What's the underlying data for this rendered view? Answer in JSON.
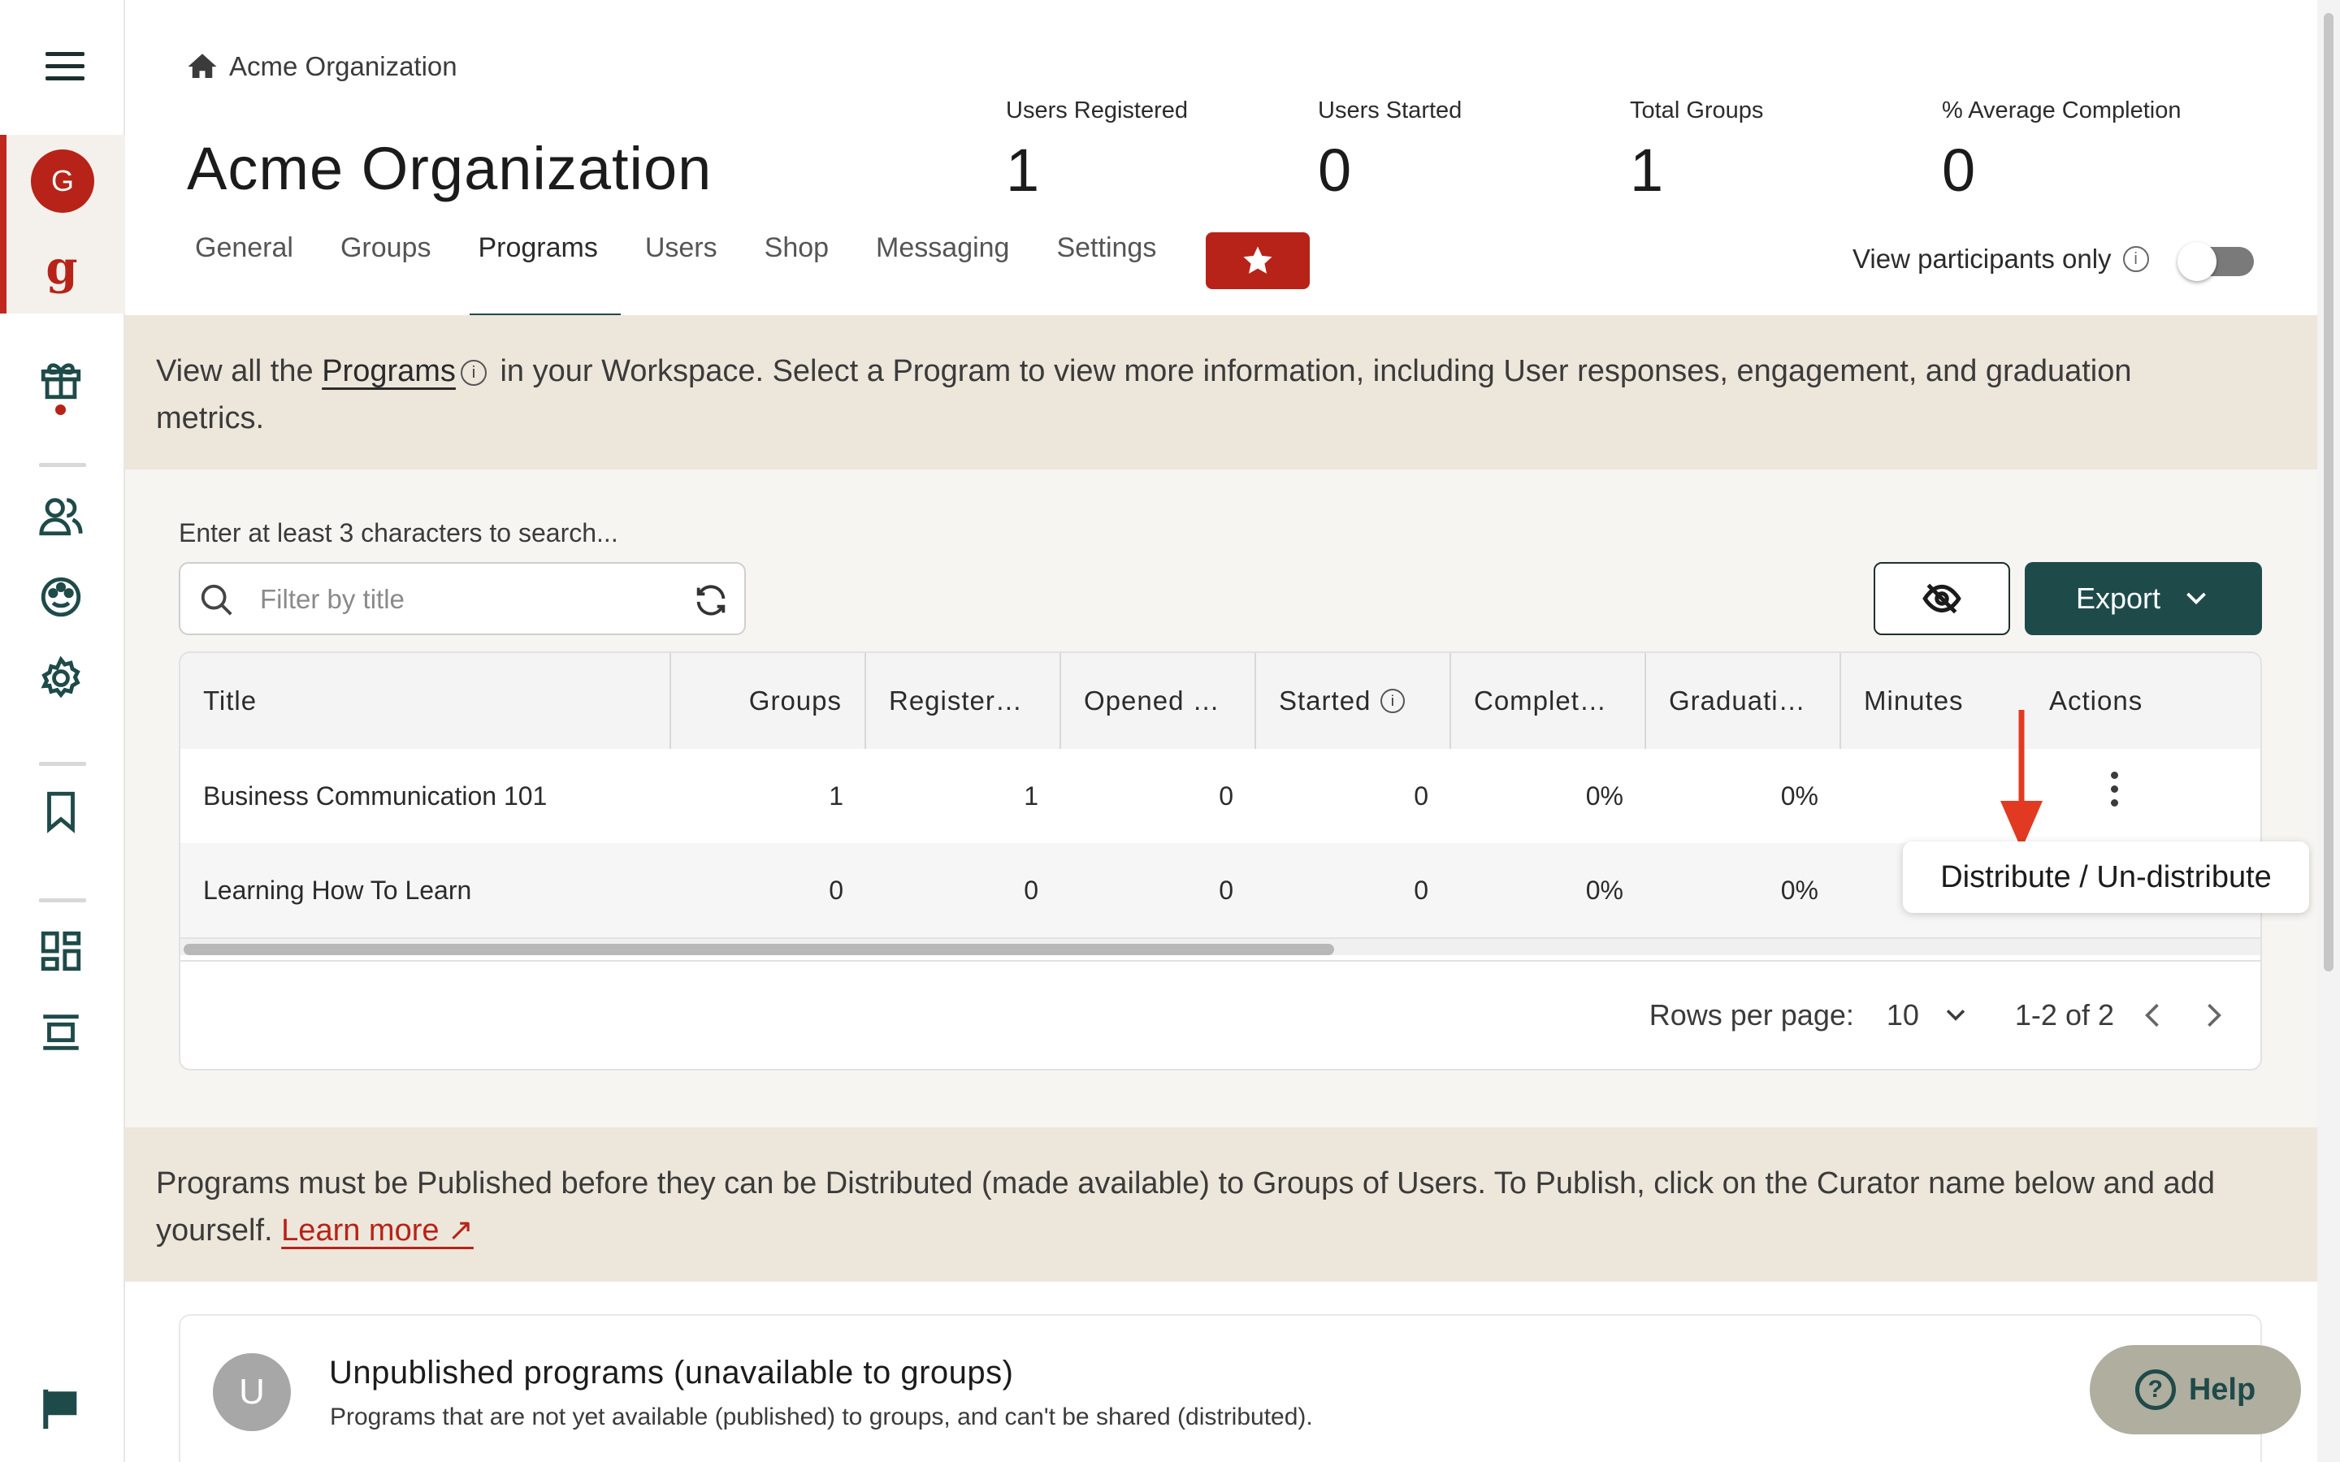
{
  "breadcrumb": {
    "label": "Acme Organization"
  },
  "page": {
    "title": "Acme Organization"
  },
  "rail": {
    "avatar_initial": "G",
    "logo_letter": "g"
  },
  "stats": [
    {
      "label": "Users Registered",
      "value": "1"
    },
    {
      "label": "Users Started",
      "value": "0"
    },
    {
      "label": "Total Groups",
      "value": "1"
    },
    {
      "label": "% Average Completion",
      "value": "0"
    }
  ],
  "tabs": [
    {
      "label": "General"
    },
    {
      "label": "Groups"
    },
    {
      "label": "Programs",
      "active": true
    },
    {
      "label": "Users"
    },
    {
      "label": "Shop"
    },
    {
      "label": "Messaging"
    },
    {
      "label": "Settings"
    }
  ],
  "view_participants": {
    "label": "View participants only",
    "enabled": false
  },
  "info_banner": {
    "before": "View all the ",
    "link": "Programs",
    "after": " in your Workspace. Select a Program to view more information, including User responses, engagement, and graduation metrics."
  },
  "search": {
    "label": "Enter at least 3 characters to search...",
    "placeholder": "Filter by title",
    "value": ""
  },
  "toolbar": {
    "export_label": "Export"
  },
  "table": {
    "columns": [
      "Title",
      "Groups",
      "Register…",
      "Opened …",
      "Started",
      "Complet…",
      "Graduati…",
      "Minutes",
      "Actions"
    ],
    "rows": [
      {
        "title": "Business Communication 101",
        "groups": "1",
        "registered": "1",
        "opened": "0",
        "started": "0",
        "completed": "0%",
        "graduation": "0%"
      },
      {
        "title": "Learning How To Learn",
        "groups": "0",
        "registered": "0",
        "opened": "0",
        "started": "0",
        "completed": "0%",
        "graduation": "0%"
      }
    ],
    "pager": {
      "rows_label": "Rows per page:",
      "rows_value": "10",
      "range": "1-2 of 2"
    }
  },
  "tooltip": {
    "text": "Distribute / Un-distribute"
  },
  "publish_banner": {
    "text": "Programs must be Published before they can be Distributed (made available) to Groups of Users. To Publish, click on the Curator name below and add yourself. ",
    "link": "Learn more ↗"
  },
  "unpublished": {
    "badge": "U",
    "title": "Unpublished programs (unavailable to groups)",
    "subtitle": "Programs that are not yet available (published) to groups, and can't be shared (distributed)."
  },
  "help": {
    "label": "Help",
    "glyph": "?"
  },
  "colors": {
    "brand_red": "#b72318",
    "teal": "#1f4a4a",
    "band": "#ede6da",
    "arrow": "#e23a22"
  }
}
